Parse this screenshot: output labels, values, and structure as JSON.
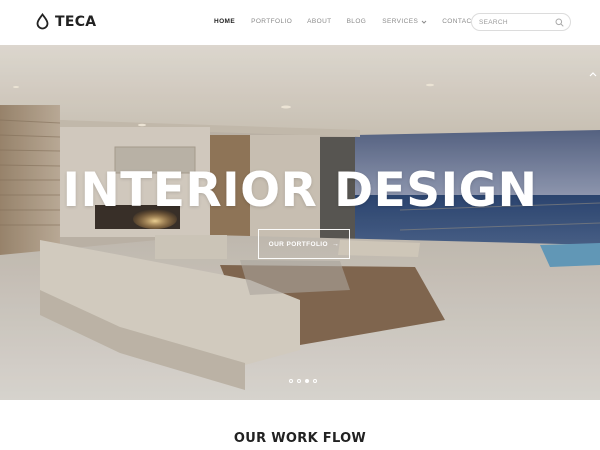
{
  "header": {
    "logo_text": "TECA",
    "nav": [
      {
        "label": "HOME"
      },
      {
        "label": "PORTFOLIO"
      },
      {
        "label": "ABOUT"
      },
      {
        "label": "BLOG"
      },
      {
        "label": "SERVICES"
      },
      {
        "label": "CONTACT"
      }
    ],
    "search_placeholder": "SEARCH"
  },
  "hero": {
    "title": "INTERIOR DESIGN",
    "button_label": "OUR PORTFOLIO",
    "button_arrow": "→",
    "slides_total": 4,
    "active_slide": 3
  },
  "section": {
    "title": "OUR WORK FLOW"
  },
  "colors": {
    "text_dark": "#222222",
    "nav_inactive": "#8a8a8a",
    "hero_text": "#ffffff"
  },
  "icons": {
    "logo": "drop-icon",
    "search": "search-icon",
    "dropdown": "chevron-down-icon",
    "scroll": "arrow-up-icon"
  }
}
